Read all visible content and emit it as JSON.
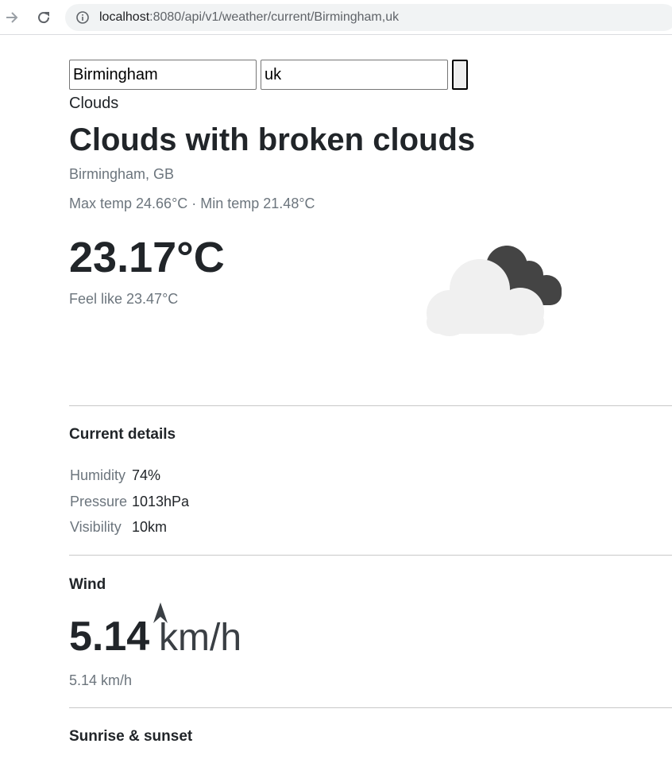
{
  "browser": {
    "url_host": "localhost",
    "url_rest": ":8080/api/v1/weather/current/Birmingham,uk"
  },
  "search": {
    "city_value": "Birmingham",
    "country_value": "uk"
  },
  "weather": {
    "main": "Clouds",
    "headline": "Clouds with broken clouds",
    "location": "Birmingham, GB",
    "temps": "Max temp 24.66°C · Min temp 21.48°C",
    "temperature": "23.17°C",
    "feels_like": "Feel like 23.47°C",
    "icon": "broken-clouds-icon"
  },
  "current_details": {
    "heading": "Current details",
    "rows": [
      {
        "label": "Humidity",
        "value": "74%"
      },
      {
        "label": "Pressure",
        "value": "1013hPa"
      },
      {
        "label": "Visibility",
        "value": "10km"
      }
    ]
  },
  "wind": {
    "heading": "Wind",
    "speed": "5.14",
    "unit": "km/h",
    "sub": "5.14 km/h",
    "arrow_icon": "wind-direction-arrow-icon"
  },
  "sunrise_sunset": {
    "heading": "Sunrise & sunset"
  },
  "colors": {
    "text": "#212529",
    "muted": "#6c757d",
    "cloud_light": "#f0f0f0",
    "cloud_dark": "#444444"
  }
}
